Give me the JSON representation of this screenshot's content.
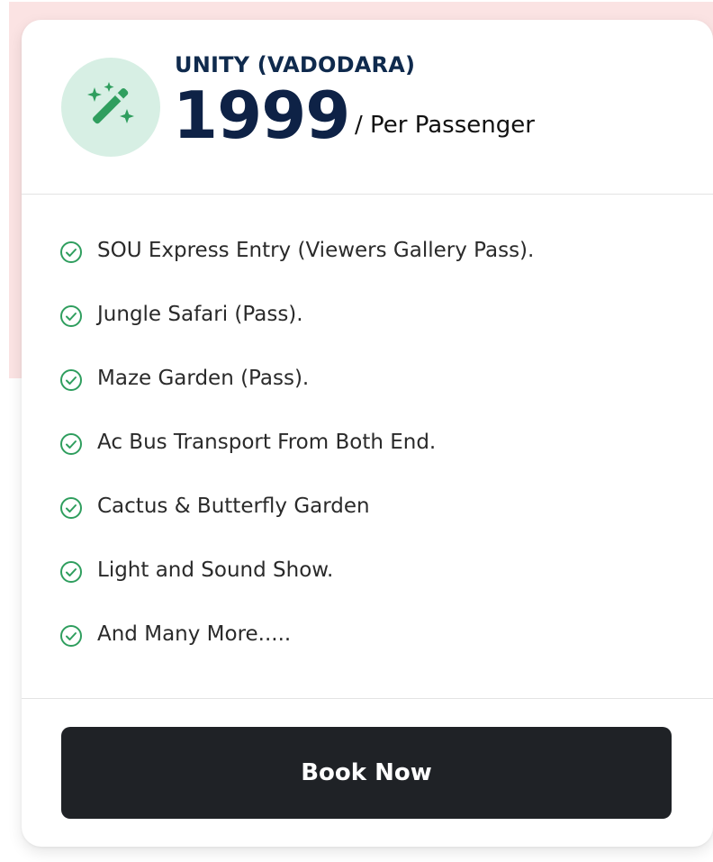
{
  "package": {
    "title": "UNITY (VADODARA)",
    "price": "1999",
    "per_unit": "/ Per Passenger",
    "icon": "magic-wand-sparkles-icon"
  },
  "features": [
    "SOU Express Entry (Viewers Gallery Pass).",
    "Jungle Safari (Pass).",
    "Maze Garden (Pass).",
    "Ac Bus Transport From Both End.",
    "Cactus & Butterfly Garden",
    "Light and Sound Show.",
    "And Many More....."
  ],
  "cta": {
    "label": "Book Now"
  },
  "colors": {
    "accent_green": "#2f9e5e",
    "icon_bg": "#d7efe4",
    "title_navy": "#0f2a4d",
    "button_bg": "#1f2226",
    "page_tint": "#fbe3e3"
  }
}
